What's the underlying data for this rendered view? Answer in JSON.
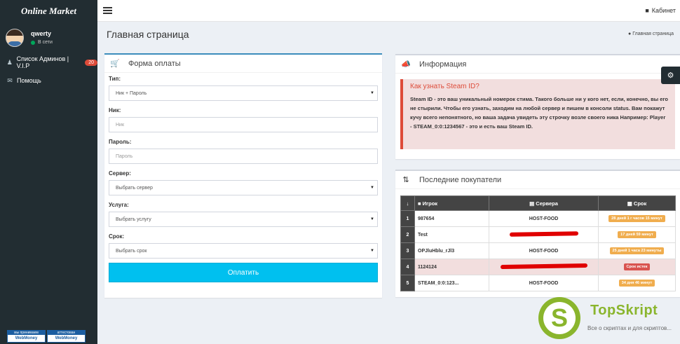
{
  "brand": {
    "logo": "Online Market"
  },
  "user": {
    "name": "qwerty",
    "status": "В сети"
  },
  "sidebar": {
    "items": [
      {
        "label": "Список Админов | V.I.P",
        "badge": "20"
      },
      {
        "label": "Помощь"
      }
    ],
    "webmoney": [
      {
        "top": "мы принимаем",
        "bottom": "WebMoney"
      },
      {
        "top": "аттестован",
        "bottom": "WebMoney"
      }
    ]
  },
  "header": {
    "cabinet": "Кабинет"
  },
  "page": {
    "title": "Главная страница",
    "breadcrumb": "Главная страница"
  },
  "form": {
    "title": "Форма оплаты",
    "type_label": "Тип:",
    "type_value": "Ник + Пароль",
    "nick_label": "Ник:",
    "nick_placeholder": "Ник",
    "password_label": "Пароль:",
    "password_placeholder": "Пароль",
    "server_label": "Сервер:",
    "server_value": "Выбрать сервер",
    "service_label": "Услуга:",
    "service_value": "Выбрать услугу",
    "term_label": "Срок:",
    "term_value": "Выбрать срок",
    "pay_button": "Оплатить"
  },
  "info": {
    "title": "Информация",
    "callout_title": "Как узнать Steam ID?",
    "callout_text": "Steam ID - это ваш уникальный номерок стима. Такого больше ни у кого нет, если, конечно, вы его не стырили. Чтобы его узнать, заходим на любой сервер и пишем в консоли status. Вам покажут кучу всего непонятного, но ваша задача увидеть эту строчку возле своего ника Например: Player - STEAM_0:0:1234567 - это и есть ваш Steam ID."
  },
  "buyers": {
    "title": "Последние покупатели",
    "columns": {
      "player": "Игрок",
      "server": "Сервера",
      "term": "Срок"
    },
    "rows": [
      {
        "num": "1",
        "player": "987654",
        "server": "HOST-FOOD",
        "term": "28 дней 1 г часов 15 минут"
      },
      {
        "num": "2",
        "player": "Test",
        "server": "",
        "term": "17 дней 59 минут"
      },
      {
        "num": "3",
        "player": "OPJluHblu_rJl3",
        "server": "HOST-FOOD",
        "term": "25 дней 1 часа 23 минуты"
      },
      {
        "num": "4",
        "player": "1124124",
        "server": "",
        "term": "Срок истек"
      },
      {
        "num": "5",
        "player": "STEAM_0:0:123...",
        "server": "HOST-FOOD",
        "term": "34 дня 46 минут"
      }
    ]
  },
  "watermark": {
    "title": "TopSkript",
    "subtitle": "Все о скриптах и для скриптов..."
  },
  "colors": {
    "primary": "#3c8dbc",
    "info": "#00c0ef",
    "danger": "#dd4b39",
    "warning": "#f0ad4e",
    "sidebar": "#222d32"
  }
}
